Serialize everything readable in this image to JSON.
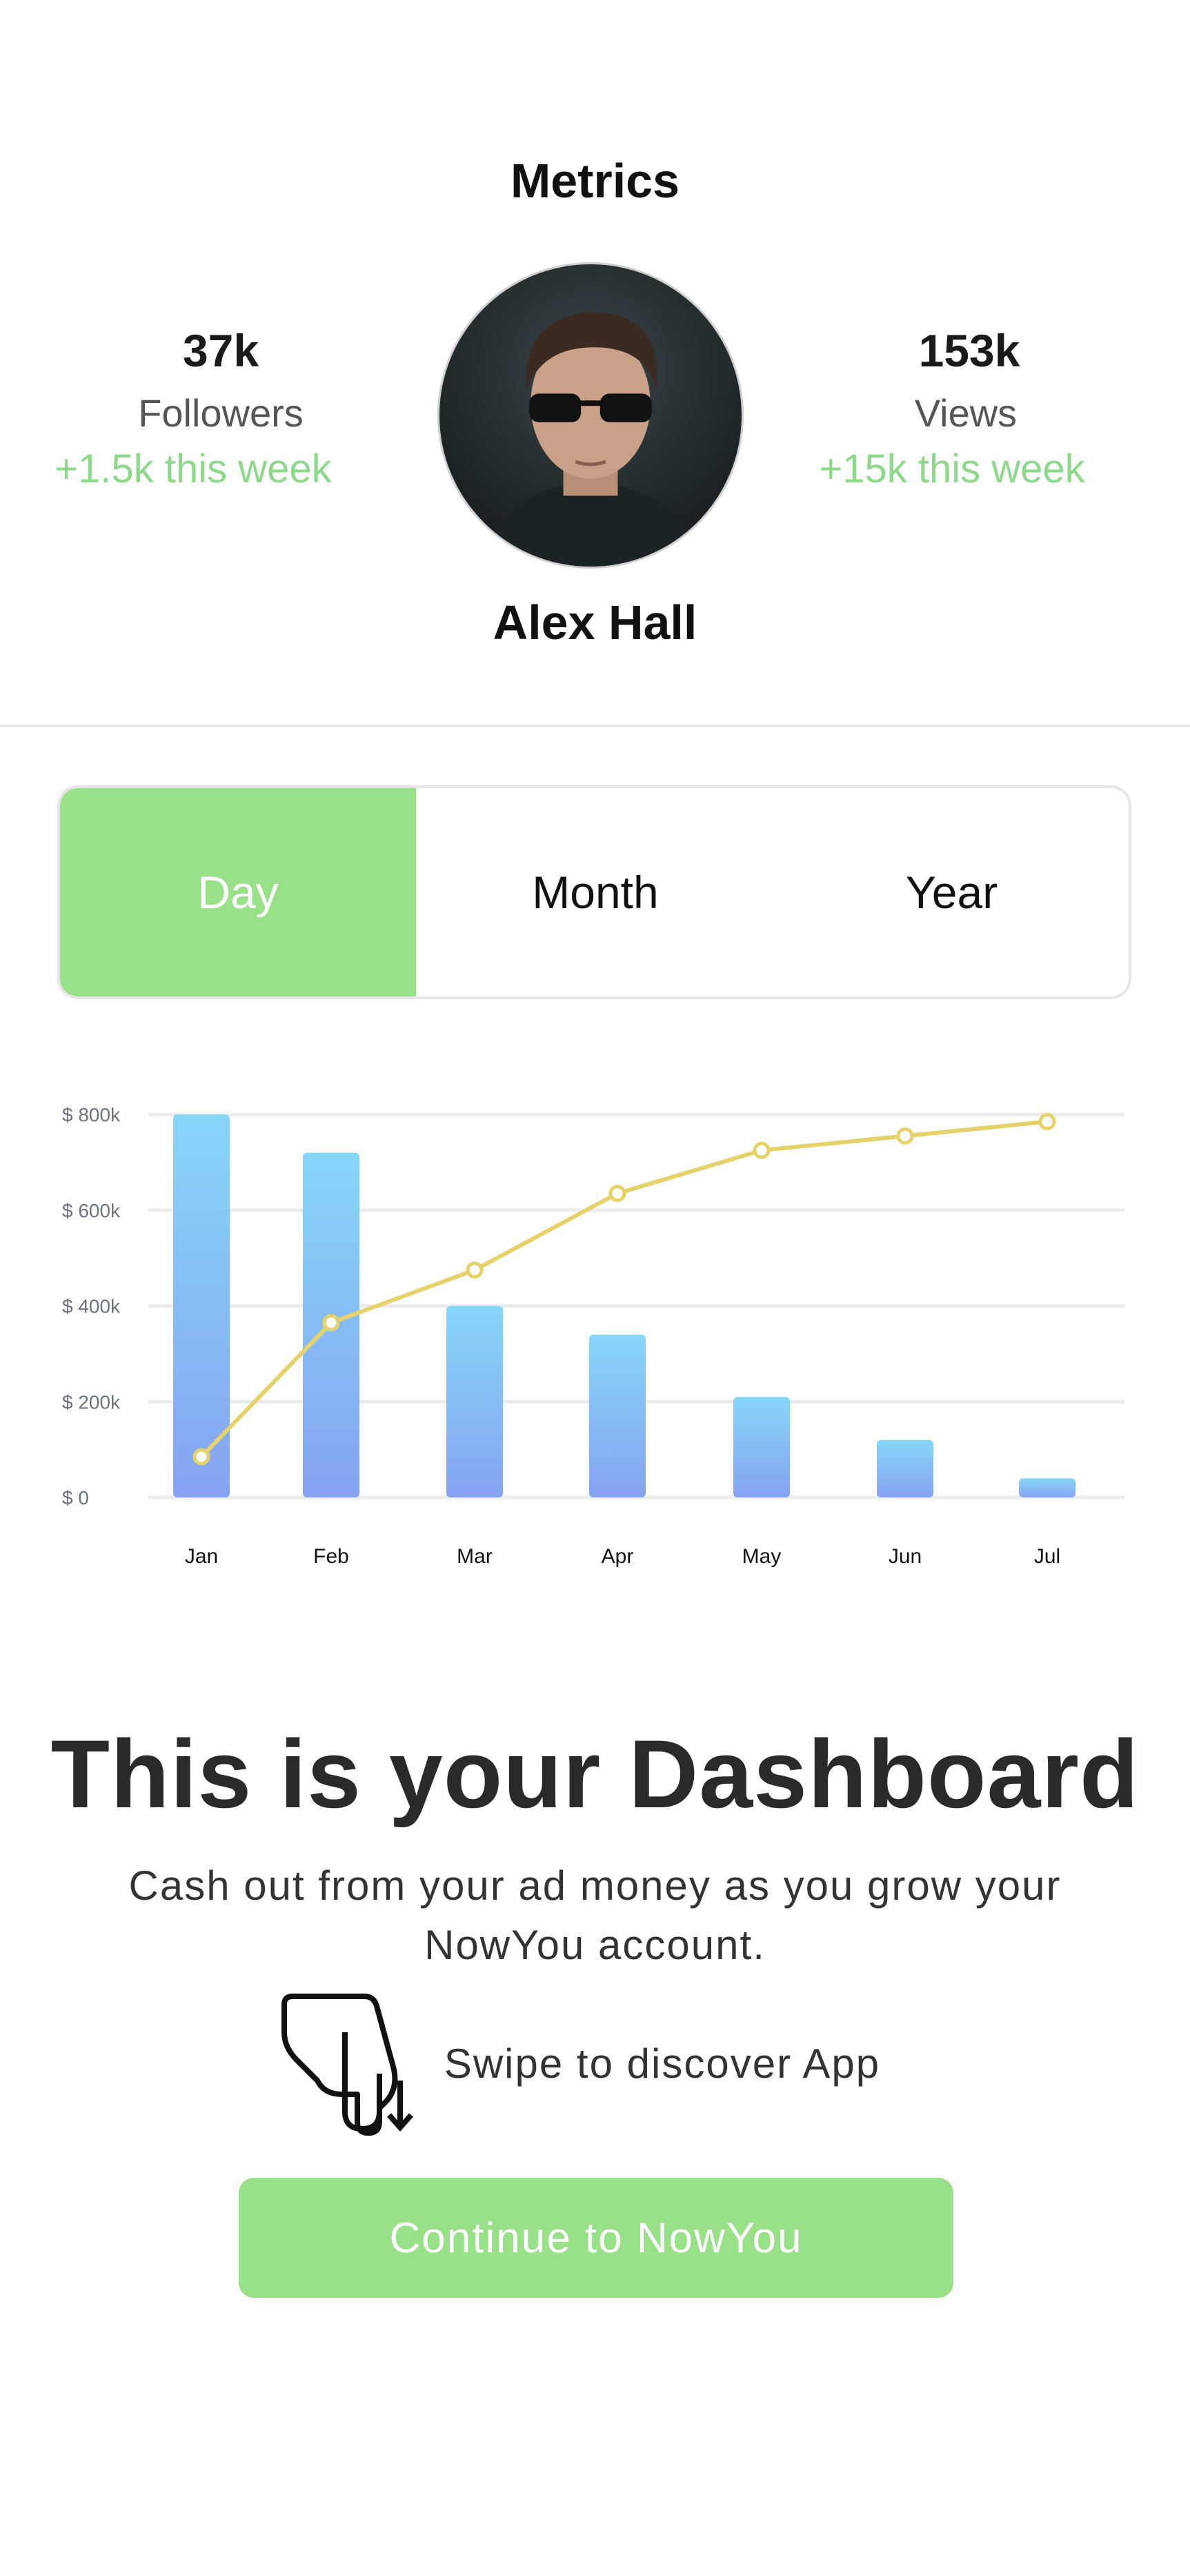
{
  "header": {
    "title": "Metrics"
  },
  "profile": {
    "name": "Alex Hall",
    "followers": {
      "value": "37k",
      "label": "Followers",
      "delta": "+1.5k this week"
    },
    "views": {
      "value": "153k",
      "label": "Views",
      "delta": "+15k this week"
    }
  },
  "period_tabs": [
    {
      "label": "Day",
      "active": true
    },
    {
      "label": "Month",
      "active": false
    },
    {
      "label": "Year",
      "active": false
    }
  ],
  "colors": {
    "accent": "#99e189",
    "delta": "#8ed88b",
    "line": "#e6d26a",
    "bar_top": "#86d6f7",
    "bar_bottom": "#86a3f2"
  },
  "chart_data": {
    "type": "bar",
    "categories": [
      "Jan",
      "Feb",
      "Mar",
      "Apr",
      "May",
      "Jun",
      "Jul"
    ],
    "y_ticks": [
      "$ 0",
      "$ 200k",
      "$ 400k",
      "$ 600k",
      "$ 800k"
    ],
    "ylim": [
      0,
      800000
    ],
    "grid": true,
    "series": [
      {
        "type": "bar",
        "values": [
          800000,
          720000,
          400000,
          340000,
          210000,
          120000,
          40000
        ]
      },
      {
        "type": "line",
        "values": [
          85000,
          365000,
          475000,
          635000,
          725000,
          755000,
          785000
        ]
      }
    ]
  },
  "intro": {
    "headline": "This is your Dashboard",
    "subtitle": "Cash out from your ad money as you grow your NowYou account.",
    "swipe_hint": "Swipe to discover App",
    "cta": "Continue to NowYou"
  }
}
